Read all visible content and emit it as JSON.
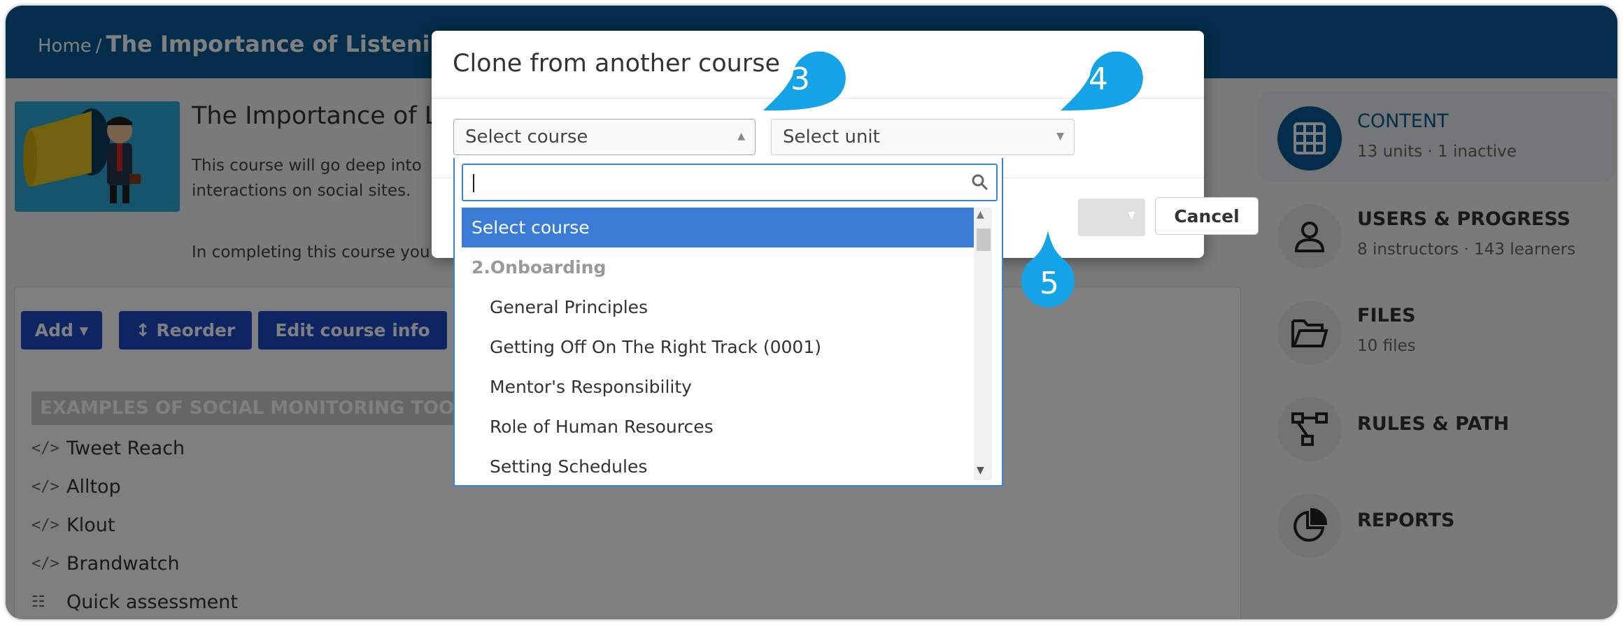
{
  "header": {
    "breadcrumb_home": "Home",
    "breadcrumb_sep": "/",
    "breadcrumb_current": "The Importance of Listening i"
  },
  "course": {
    "title": "The Importance of L",
    "desc_line1": "This course will go deep into",
    "desc_line2": "interactions on social sites.",
    "desc_line3": "In completing this course you w"
  },
  "toolbar": {
    "add_label": "Add ▾",
    "reorder_label": "↕ Reorder",
    "edit_info_label": "Edit course info"
  },
  "section": {
    "name": "EXAMPLES OF SOCIAL MONITORING TOOLS"
  },
  "units": [
    {
      "name": "Tweet Reach",
      "icon": "code-icon"
    },
    {
      "name": "Alltop",
      "icon": "code-icon"
    },
    {
      "name": "Klout",
      "icon": "code-icon"
    },
    {
      "name": "Brandwatch",
      "icon": "code-icon"
    },
    {
      "name": "Quick assessment",
      "icon": "test-icon"
    }
  ],
  "sidebar": {
    "items": [
      {
        "title": "CONTENT",
        "subtitle": "13 units · 1 inactive",
        "icon": "grid-icon",
        "active": true
      },
      {
        "title": "USERS & PROGRESS",
        "subtitle": "8 instructors · 143 learners",
        "icon": "user-icon"
      },
      {
        "title": "FILES",
        "subtitle": "10 files",
        "icon": "folder-icon"
      },
      {
        "title": "RULES & PATH",
        "subtitle": "",
        "icon": "path-icon"
      },
      {
        "title": "REPORTS",
        "subtitle": "",
        "icon": "pie-chart-icon"
      }
    ]
  },
  "modal": {
    "title": "Clone from another course",
    "course_select_value": "Select course",
    "unit_select_value": "Select unit",
    "cancel_label": "Cancel"
  },
  "dropdown": {
    "search_placeholder": "",
    "items": [
      {
        "label": "Select course",
        "kind": "selected"
      },
      {
        "label": "2.Onboarding",
        "kind": "group"
      },
      {
        "label": "General Principles",
        "kind": "option"
      },
      {
        "label": "Getting Off On The Right Track (0001)",
        "kind": "option"
      },
      {
        "label": "Mentor's Responsibility",
        "kind": "option"
      },
      {
        "label": "Role of Human Resources",
        "kind": "option"
      },
      {
        "label": "Setting Schedules",
        "kind": "option"
      }
    ]
  },
  "callouts": [
    "3",
    "4",
    "5"
  ],
  "colors": {
    "header": "#075b95",
    "primary_button": "#1f49c6",
    "callout": "#14a3e6",
    "selected_item": "#3a7bd5"
  }
}
